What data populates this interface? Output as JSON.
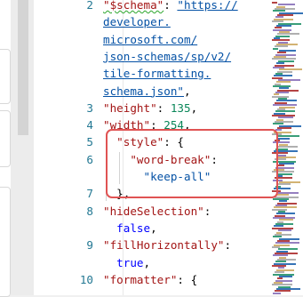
{
  "editor": {
    "lines": [
      {
        "number": "2",
        "segments": [
          {
            "text": "\"$schema\"",
            "cls": "key squiggle"
          },
          {
            "text": ": ",
            "cls": "pun"
          },
          {
            "text": "\"https://",
            "cls": "str link"
          }
        ]
      },
      {
        "number": "",
        "segments": [
          {
            "text": "developer.",
            "cls": "str link"
          }
        ]
      },
      {
        "number": "",
        "segments": [
          {
            "text": "microsoft.com/",
            "cls": "str link"
          }
        ]
      },
      {
        "number": "",
        "segments": [
          {
            "text": "json-schemas/sp/v2/",
            "cls": "str link"
          }
        ]
      },
      {
        "number": "",
        "segments": [
          {
            "text": "tile-formatting.",
            "cls": "str link"
          }
        ]
      },
      {
        "number": "",
        "segments": [
          {
            "text": "schema.json\"",
            "cls": "str link"
          },
          {
            "text": ",",
            "cls": "pun"
          }
        ]
      },
      {
        "number": "3",
        "segments": [
          {
            "text": "\"height\"",
            "cls": "key"
          },
          {
            "text": ": ",
            "cls": "pun"
          },
          {
            "text": "135",
            "cls": "num"
          },
          {
            "text": ",",
            "cls": "pun"
          }
        ]
      },
      {
        "number": "4",
        "segments": [
          {
            "text": "\"width\"",
            "cls": "key"
          },
          {
            "text": ": ",
            "cls": "pun"
          },
          {
            "text": "254",
            "cls": "num"
          },
          {
            "text": ",",
            "cls": "pun"
          }
        ]
      },
      {
        "number": "5",
        "segments": [
          {
            "text": "  \"style\"",
            "cls": "key"
          },
          {
            "text": ": {",
            "cls": "pun"
          }
        ]
      },
      {
        "number": "6",
        "segments": [
          {
            "text": "    \"word-break\"",
            "cls": "key"
          },
          {
            "text": ":",
            "cls": "pun"
          }
        ]
      },
      {
        "number": "",
        "segments": [
          {
            "text": "      \"keep-all\"",
            "cls": "str"
          }
        ]
      },
      {
        "number": "7",
        "segments": [
          {
            "text": "  },",
            "cls": "pun"
          }
        ]
      },
      {
        "number": "8",
        "segments": [
          {
            "text": "\"hideSelection\"",
            "cls": "key"
          },
          {
            "text": ":",
            "cls": "pun"
          }
        ]
      },
      {
        "number": "",
        "segments": [
          {
            "text": "  false",
            "cls": "kw"
          },
          {
            "text": ",",
            "cls": "pun"
          }
        ]
      },
      {
        "number": "9",
        "segments": [
          {
            "text": "\"fillHorizontally\"",
            "cls": "key"
          },
          {
            "text": ":",
            "cls": "pun"
          }
        ]
      },
      {
        "number": "",
        "segments": [
          {
            "text": "  true",
            "cls": "kw"
          },
          {
            "text": ",",
            "cls": "pun"
          }
        ]
      },
      {
        "number": "10",
        "segments": [
          {
            "text": "\"formatter\"",
            "cls": "key"
          },
          {
            "text": ": {",
            "cls": "pun"
          }
        ]
      }
    ]
  },
  "colors": {
    "annotation_box": "#e05353",
    "line_number": "#237893",
    "json_key": "#a31515",
    "json_string": "#0451a5",
    "json_number": "#098658",
    "json_keyword": "#0000ff",
    "lint_squiggle": "#2aa52a"
  }
}
